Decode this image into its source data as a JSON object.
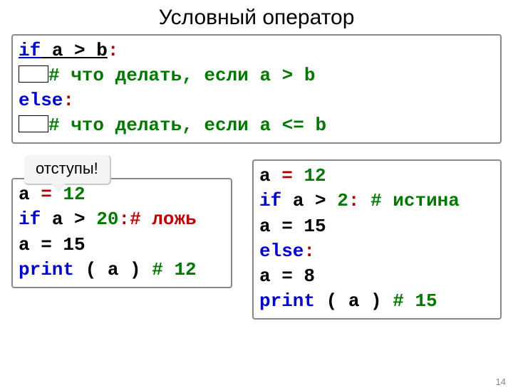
{
  "title": "Условный оператор",
  "main": {
    "l1_if": "if",
    "l1_cond": " a > b",
    "l1_colon": ":",
    "l2_comment": "# что делать, если a > b",
    "l3_else": "else",
    "l3_colon": ":",
    "l4_comment": "# что делать, если a <= b"
  },
  "callout": "отступы!",
  "left": {
    "l1_a": "a ",
    "l1_eq": "=",
    "l1_sp": " ",
    "l1_num": "12",
    "l2_if": "if",
    "l2_cond": " a > ",
    "l2_num": "20",
    "l2_colon": ":",
    "l2_cm": "# ложь",
    "l3": "  a = 15",
    "l4_print": "print",
    "l4_args": " ( a ) ",
    "l4_cm": "# 12"
  },
  "right": {
    "l1_a": "a ",
    "l1_eq": "=",
    "l1_sp": " ",
    "l1_num": "12",
    "l2_if": "if",
    "l2_cond": " a > ",
    "l2_num": "2",
    "l2_colon": ":",
    "l2_gap": "   ",
    "l2_cm": "# истина",
    "l3": "  a = 15",
    "l4_else": "else",
    "l4_colon": ":",
    "l5": "  a = 8",
    "l6_print": "print",
    "l6_args": " ( a ) ",
    "l6_cm": "# 15"
  },
  "pagenum": "14"
}
